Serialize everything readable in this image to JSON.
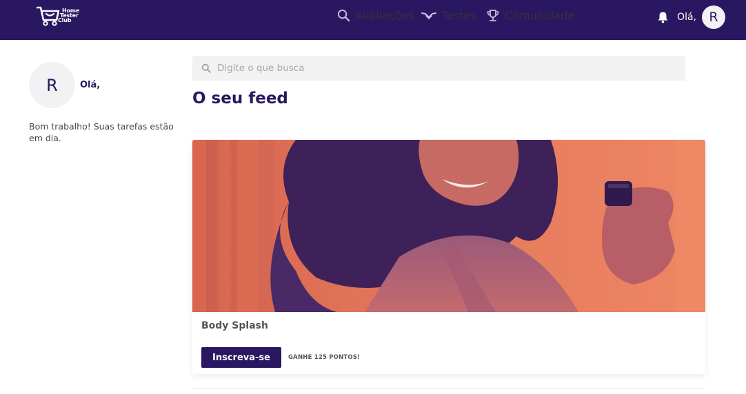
{
  "brand": {
    "logo_lines": [
      "Home",
      "Tester",
      "Club"
    ]
  },
  "nav": {
    "items": [
      {
        "label": "Avaliações",
        "icon": "search-icon"
      },
      {
        "label": "Testes",
        "icon": "hands-icon"
      },
      {
        "label": "Comunidade",
        "icon": "trophy-icon"
      }
    ]
  },
  "user": {
    "greeting": "Olá,",
    "avatar_initial": "R",
    "status_message": "Bom trabalho! Suas tarefas estão em dia."
  },
  "search": {
    "placeholder": "Digite o que busca"
  },
  "feed": {
    "title": "O seu feed",
    "cards": [
      {
        "title": "Body Splash",
        "button_label": "Inscreva-se",
        "points_text": "GANHE 125 PONTOS!"
      }
    ]
  },
  "colors": {
    "brand": "#2a1761",
    "image_coral": "#e8785c",
    "image_purple": "#4a2c6e"
  }
}
